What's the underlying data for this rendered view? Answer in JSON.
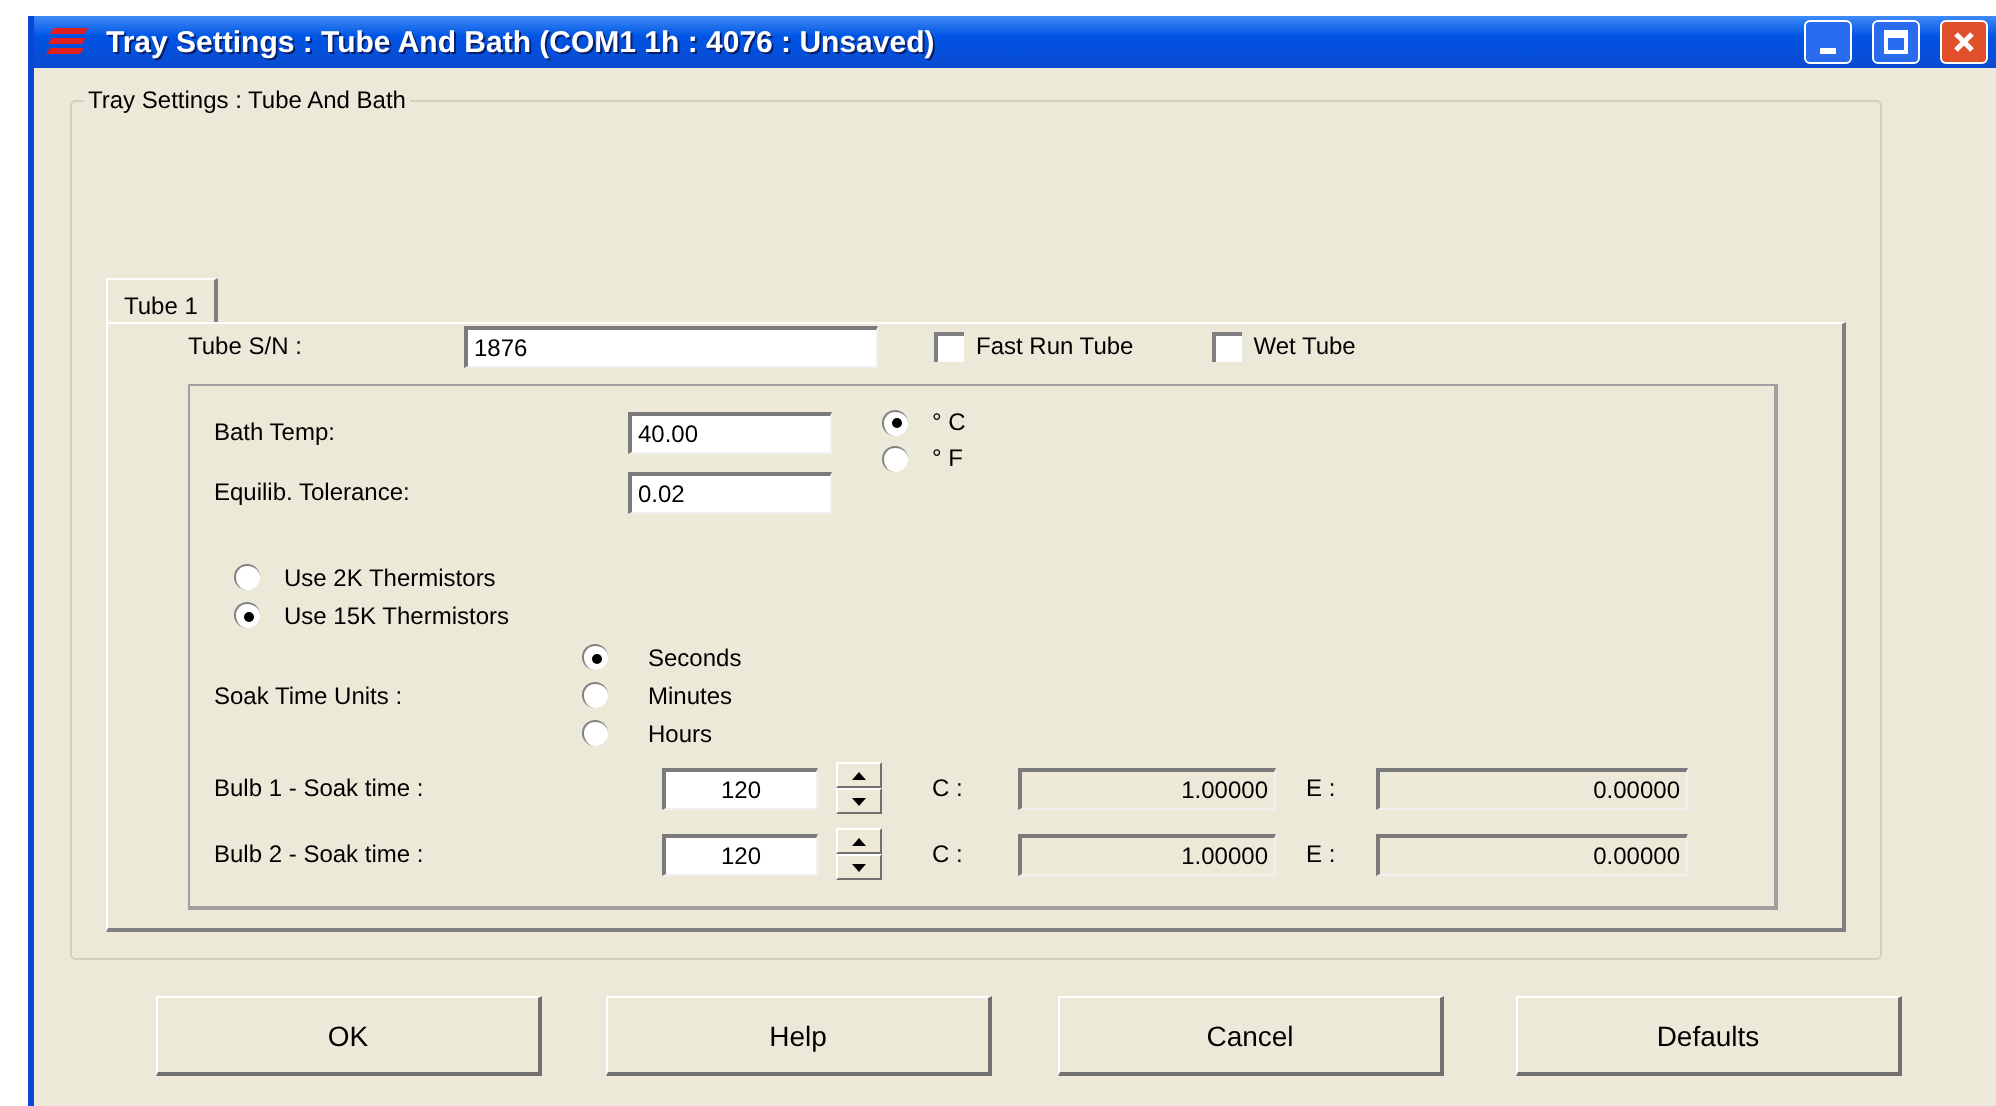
{
  "window": {
    "title": "Tray Settings : Tube And Bath (COM1 1h : 4076 : Unsaved)"
  },
  "group": {
    "label": "Tray Settings : Tube And Bath"
  },
  "tabs": [
    {
      "label": "Tube 1",
      "selected": true
    }
  ],
  "serial": {
    "label": "Tube S/N :",
    "value": "1876"
  },
  "checkboxes": [
    {
      "label": "Fast Run Tube",
      "checked": false
    },
    {
      "label": "Wet Tube",
      "checked": false
    }
  ],
  "bath_temp": {
    "label": "Bath Temp:",
    "value": "40.00"
  },
  "tolerance": {
    "label": "Equilib. Tolerance:",
    "value": "0.02"
  },
  "temp_units": [
    {
      "label": "° C",
      "selected": true
    },
    {
      "label": "° F",
      "selected": false
    }
  ],
  "thermistors": [
    {
      "label": "Use 2K Thermistors",
      "selected": false
    },
    {
      "label": "Use 15K Thermistors",
      "selected": true
    }
  ],
  "soak_units": {
    "label": "Soak Time Units :",
    "options": [
      {
        "label": "Seconds",
        "selected": true
      },
      {
        "label": "Minutes",
        "selected": false
      },
      {
        "label": "Hours",
        "selected": false
      }
    ]
  },
  "bulbs": [
    {
      "label": "Bulb 1 -  Soak time  :",
      "value": "120",
      "c_label": "C :",
      "c_value": "1.00000",
      "e_label": "E :",
      "e_value": "0.00000"
    },
    {
      "label": "Bulb 2 -  Soak time  :",
      "value": "120",
      "c_label": "C :",
      "c_value": "1.00000",
      "e_label": "E :",
      "e_value": "0.00000"
    }
  ],
  "buttons": [
    {
      "label": "OK"
    },
    {
      "label": "Help"
    },
    {
      "label": "Cancel"
    },
    {
      "label": "Defaults"
    }
  ]
}
